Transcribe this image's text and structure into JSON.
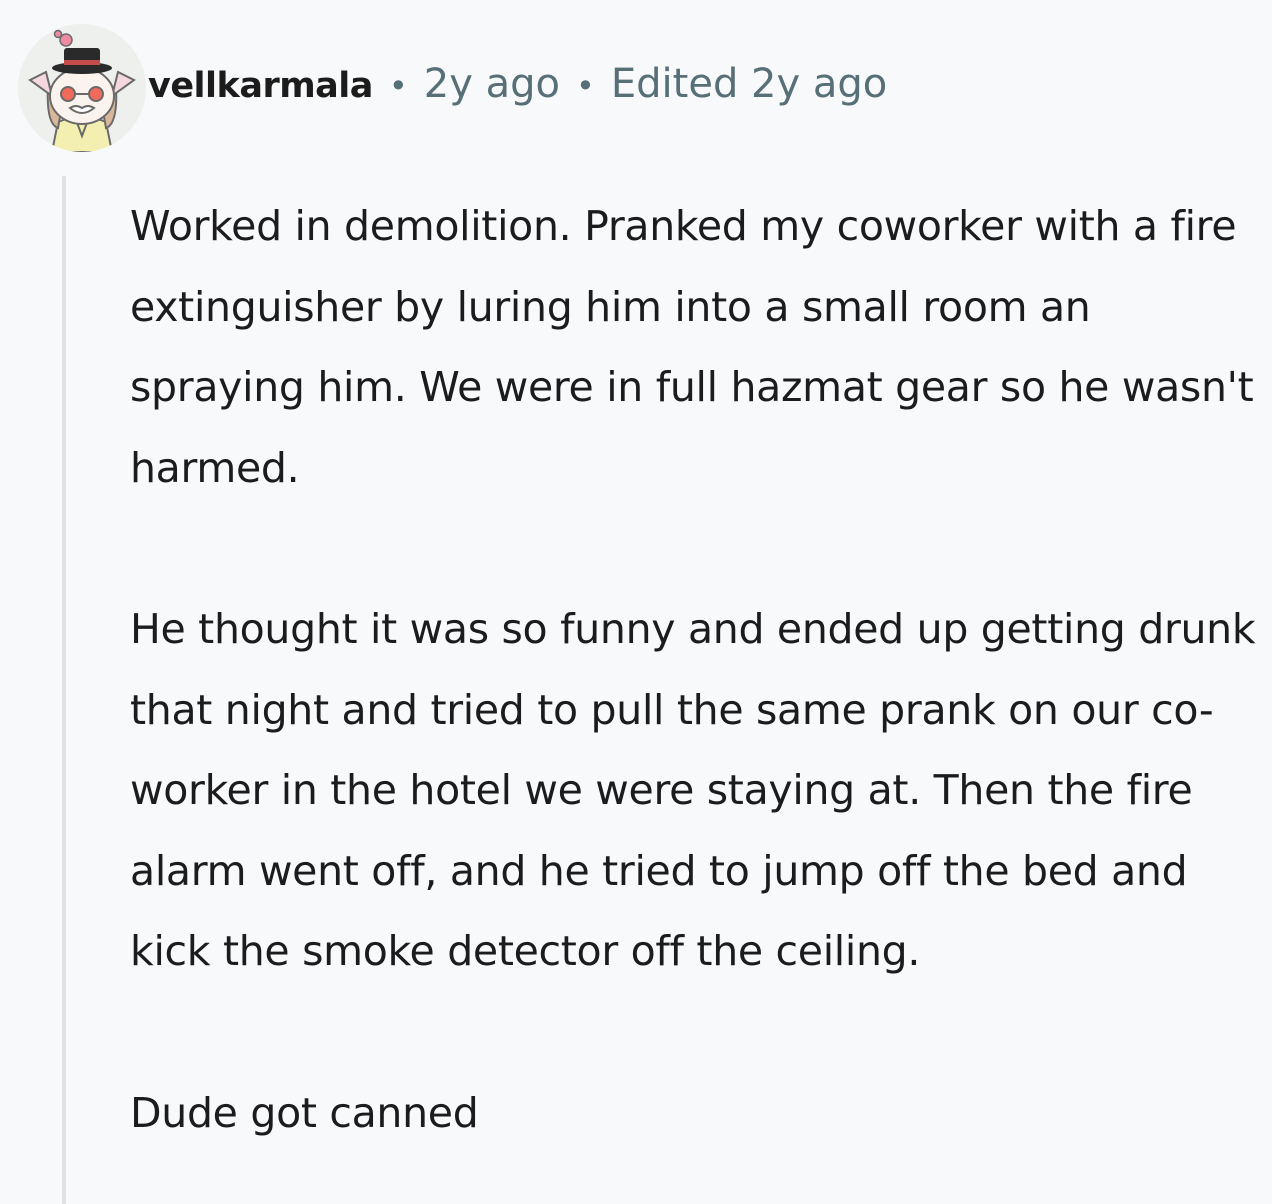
{
  "comment": {
    "author": "vellkarmala",
    "separator": "•",
    "age": "2y ago",
    "edited": "Edited 2y ago",
    "avatar_icon": "cartoon-cat-avatar-icon",
    "paragraphs": [
      "Worked in demolition. Pranked my coworker with a fire extinguisher by luring him into a small room an spraying him. We were in full hazmat gear so he wasn't harmed.",
      "He thought it was so funny and ended up getting drunk that night and tried to pull the same prank on our co-worker in the hotel we were staying at. Then the fire alarm went off, and he tried to jump off the bed and kick the smoke detector off the ceiling.",
      "Dude got canned"
    ]
  },
  "colors": {
    "background": "#f8f9fb",
    "text": "#1c1c1c",
    "meta_text": "#576f76",
    "thread_line": "#dfe3e6"
  }
}
